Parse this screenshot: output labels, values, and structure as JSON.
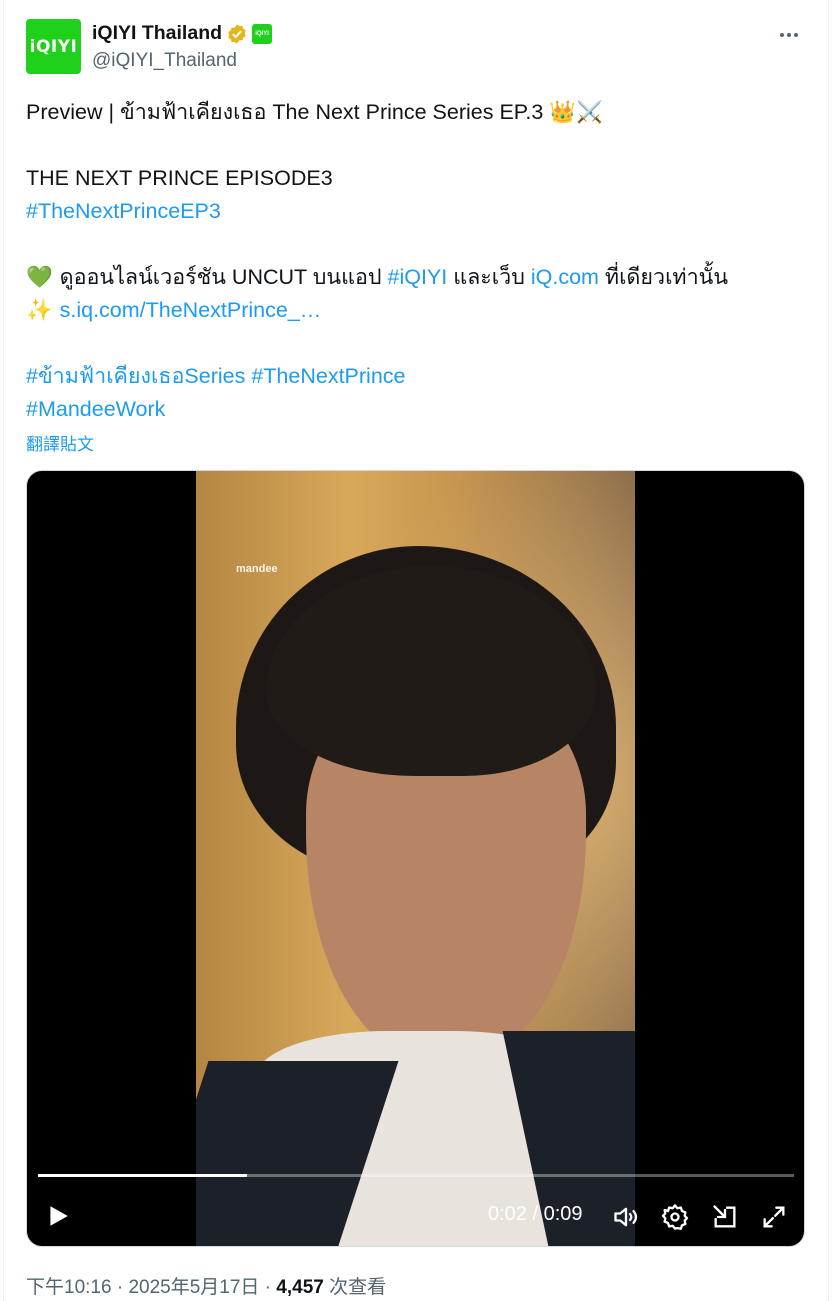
{
  "author": {
    "avatar_text": "iQIYI",
    "display_name": "iQIYI Thailand",
    "handle": "@iQIYI_Thailand",
    "affiliate_badge_text": "iQIYI",
    "verified_color": "#e2b719"
  },
  "tweet": {
    "lines": [
      {
        "parts": [
          {
            "t": "Preview | ข้ามฟ้าเคียงเธอ The Next Prince Series EP.3 ",
            "link": false
          },
          {
            "t": "👑⚔️",
            "link": false,
            "emoji": true
          }
        ]
      },
      {
        "gap": true
      },
      {
        "parts": [
          {
            "t": "THE NEXT PRINCE EPISODE3",
            "link": false
          }
        ]
      },
      {
        "parts": [
          {
            "t": "#TheNextPrinceEP3",
            "link": true
          }
        ]
      },
      {
        "gap": true
      },
      {
        "parts": [
          {
            "t": "💚 ",
            "link": false,
            "emoji": true
          },
          {
            "t": "ดูออนไลน์เวอร์ชัน UNCUT บนแอป ",
            "link": false
          },
          {
            "t": "#iQIYI",
            "link": true
          },
          {
            "t": " และเว็บ ",
            "link": false
          },
          {
            "t": "iQ.com",
            "link": true
          },
          {
            "t": " ที่เดียวเท่านั้น",
            "link": false
          }
        ]
      },
      {
        "parts": [
          {
            "t": "✨ ",
            "link": false,
            "emoji": true
          },
          {
            "t": "s.iq.com/TheNextPrince_…",
            "link": true
          }
        ]
      },
      {
        "gap": true
      },
      {
        "parts": [
          {
            "t": "#ข้ามฟ้าเคียงเธอSeries",
            "link": true
          },
          {
            "t": " ",
            "link": false
          },
          {
            "t": "#TheNextPrince",
            "link": true
          }
        ]
      },
      {
        "parts": [
          {
            "t": "#MandeeWork",
            "link": true
          }
        ]
      }
    ],
    "translate_label": "翻譯貼文"
  },
  "video": {
    "watermark": "mandee",
    "current_time": "0:02",
    "separator": " / ",
    "duration": "0:09",
    "progress": 0.277
  },
  "icons": {
    "more": "more-icon",
    "play": "play-icon",
    "volume": "volume-icon",
    "settings": "settings-icon",
    "pip": "picture-in-picture-icon",
    "fullscreen": "fullscreen-icon"
  },
  "meta": {
    "time": "下午10:16",
    "dot1": " · ",
    "date": "2025年5月17日",
    "dot2": " · ",
    "views": "4,457",
    "views_label": " 次查看"
  },
  "colors": {
    "link": "#1d9bf0",
    "secondary": "#536471",
    "brand": "#1fd11a"
  }
}
